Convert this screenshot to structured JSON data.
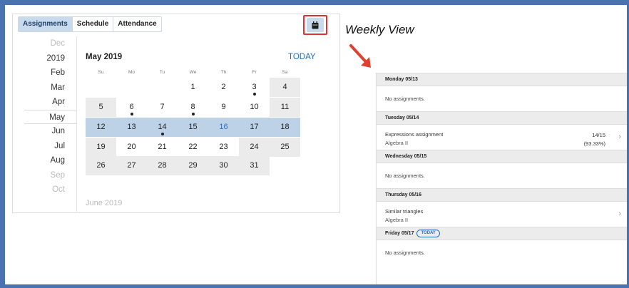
{
  "tabs": [
    {
      "label": "Assignments",
      "active": true
    },
    {
      "label": "Schedule",
      "active": false
    },
    {
      "label": "Attendance",
      "active": false
    }
  ],
  "calendar_toggle": {
    "icon": "calendar-icon"
  },
  "month_list": [
    "Dec",
    "2019",
    "Feb",
    "Mar",
    "Apr",
    "May",
    "Jun",
    "Jul",
    "Aug",
    "Sep",
    "Oct"
  ],
  "calendar": {
    "title": "May 2019",
    "today_label": "TODAY",
    "next_title": "June 2019",
    "weekdays": [
      "Su",
      "Mo",
      "Tu",
      "We",
      "Th",
      "Fr",
      "Sa"
    ],
    "days": {
      "d1": "1",
      "d2": "2",
      "d3": "3",
      "d4": "4",
      "d5": "5",
      "d6": "6",
      "d7": "7",
      "d8": "8",
      "d9": "9",
      "d10": "10",
      "d11": "11",
      "d12": "12",
      "d13": "13",
      "d14": "14",
      "d15": "15",
      "d16": "16",
      "d17": "17",
      "d18": "18",
      "d19": "19",
      "d20": "20",
      "d21": "21",
      "d22": "22",
      "d23": "23",
      "d24": "24",
      "d25": "25",
      "d26": "26",
      "d27": "27",
      "d28": "28",
      "d29": "29",
      "d30": "30",
      "d31": "31"
    },
    "days_with_assignments": [
      3,
      6,
      8,
      14
    ],
    "selected_week": [
      12,
      13,
      14,
      15,
      16,
      17,
      18
    ],
    "today": 16
  },
  "annotation": {
    "label": "Weekly View"
  },
  "weekly": {
    "monday": {
      "label": "Monday 05/13",
      "empty": "No assignments."
    },
    "tuesday": {
      "label": "Tuesday 05/14",
      "assignment": {
        "title": "Expressions assignment",
        "course": "Algebra II",
        "score": "14/15",
        "percent": "(93.33%)"
      }
    },
    "wednesday": {
      "label": "Wednesday 05/15",
      "empty": "No assignments."
    },
    "thursday": {
      "label": "Thursday 05/16",
      "assignment": {
        "title": "Similar triangles",
        "course": "Algebra II"
      }
    },
    "friday": {
      "label": "Friday 05/17",
      "badge": "TODAY",
      "empty": "No assignments."
    }
  },
  "colors": {
    "accent": "#2a6ebb",
    "selected_week": "#bed2e7",
    "highlight_box": "#dd3333",
    "frame": "#4a72b0"
  }
}
